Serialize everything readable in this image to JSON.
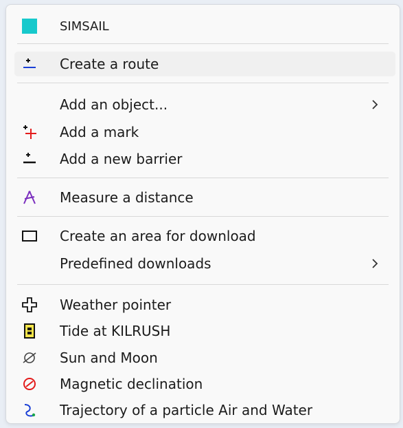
{
  "header": {
    "title": "SIMSAIL",
    "swatch_color": "#17c9cc"
  },
  "menu": {
    "create_route": "Create a route",
    "add_object": "Add an object...",
    "add_mark": "Add a mark",
    "add_barrier": "Add a new barrier",
    "measure_distance": "Measure a distance",
    "create_area": "Create an area for download",
    "predefined_downloads": "Predefined downloads",
    "weather_pointer": "Weather pointer",
    "tide": "Tide at KILRUSH",
    "sun_moon": "Sun and Moon",
    "magnetic_declination": "Magnetic declination",
    "trajectory": "Trajectory of a particle Air and Water"
  },
  "icons": {
    "header": "cyan-square-icon",
    "create_route": "plus-underline-blue-icon",
    "add_mark": "plus-red-icon",
    "add_barrier": "plus-underline-black-icon",
    "measure_distance": "compass-purple-icon",
    "create_area": "rectangle-icon",
    "weather_pointer": "cross-pointer-icon",
    "tide": "tide-gauge-icon",
    "sun_moon": "planet-icon",
    "magnetic_declination": "no-entry-red-icon",
    "trajectory": "trajectory-icon"
  },
  "colors": {
    "menu_background": "#f9f9f9",
    "highlight": "#f0f0f0",
    "separator": "#d8d8d8"
  }
}
